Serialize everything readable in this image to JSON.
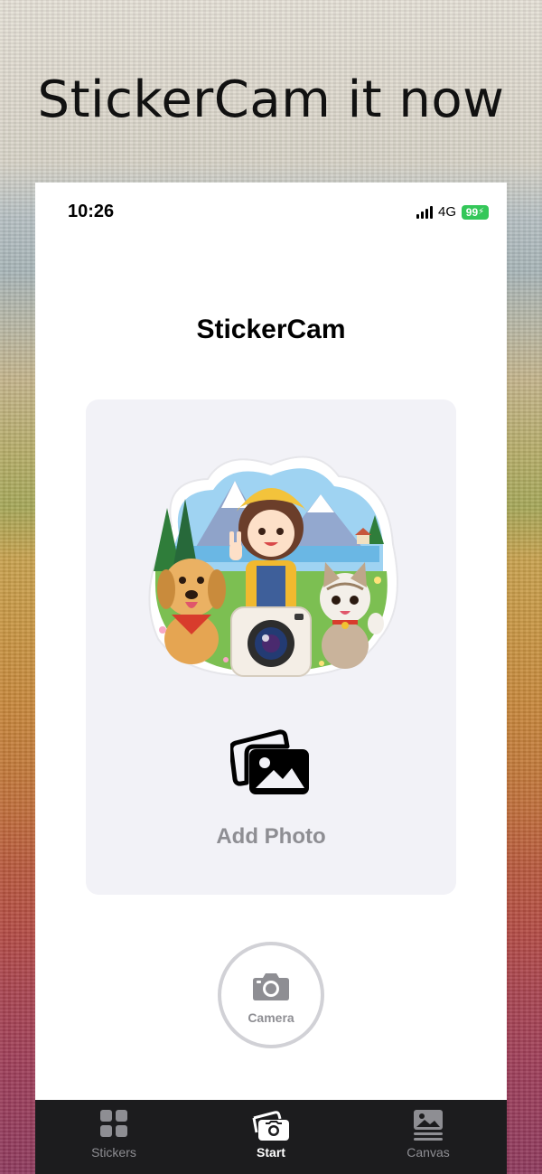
{
  "headline": "StickerCam it now",
  "status_bar": {
    "time": "10:26",
    "network": "4G",
    "battery": "99"
  },
  "app": {
    "title": "StickerCam",
    "photo_card": {
      "add_photo_label": "Add Photo"
    },
    "camera_button": {
      "label": "Camera"
    }
  },
  "tab_bar": {
    "tabs": [
      {
        "label": "Stickers",
        "icon": "grid-icon",
        "active": false
      },
      {
        "label": "Start",
        "icon": "photo-stack-icon",
        "active": true
      },
      {
        "label": "Canvas",
        "icon": "canvas-icon",
        "active": false
      }
    ]
  },
  "colors": {
    "battery": "#34c759",
    "tab_bar_background": "#1c1c1e",
    "card_background": "#f2f2f7",
    "muted_text": "#8e8e93"
  }
}
